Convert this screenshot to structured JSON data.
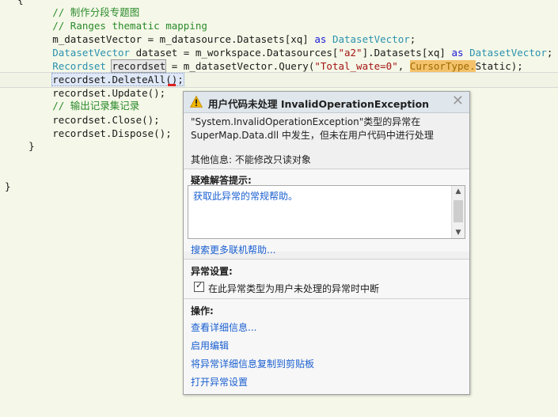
{
  "code": {
    "lines": [
      {
        "parts": [
          {
            "t": "        "
          },
          {
            "t": "// 制作分段专题图",
            "c": "comment"
          }
        ]
      },
      {
        "parts": [
          {
            "t": "        "
          },
          {
            "t": "// Ranges thematic mapping",
            "c": "comment"
          }
        ]
      },
      {
        "parts": [
          {
            "t": "        m_datasetVector = m_datasource.Datasets[xq] "
          },
          {
            "t": "as",
            "c": "kw"
          },
          {
            "t": " "
          },
          {
            "t": "DatasetVector",
            "c": "type"
          },
          {
            "t": ";"
          }
        ]
      },
      {
        "parts": [
          {
            "t": "        "
          },
          {
            "t": "DatasetVector",
            "c": "type"
          },
          {
            "t": " dataset = m_workspace.Datasources["
          },
          {
            "t": "\"a2\"",
            "c": "str"
          },
          {
            "t": "].Datasets[xq] "
          },
          {
            "t": "as",
            "c": "kw"
          },
          {
            "t": " "
          },
          {
            "t": "DatasetVector",
            "c": "type"
          },
          {
            "t": ";"
          }
        ]
      },
      {
        "parts": [
          {
            "t": "        "
          },
          {
            "t": "Recordset",
            "c": "type"
          },
          {
            "t": " "
          },
          {
            "t": "recordset",
            "c": "hl-ref"
          },
          {
            "t": " = m_datasetVector.Query("
          },
          {
            "t": "\"Total_wate=0\"",
            "c": "str"
          },
          {
            "t": ", "
          },
          {
            "t": "CursorType.",
            "c": "hl-warn"
          },
          {
            "t": "Static);"
          }
        ]
      },
      {
        "parts": [
          {
            "t": "        "
          },
          {
            "t": "recordset.DeleteAll();",
            "c": "cur-stmt"
          }
        ]
      },
      {
        "parts": [
          {
            "t": "        recordset.Update();"
          }
        ]
      },
      {
        "parts": [
          {
            "t": "        "
          },
          {
            "t": "// 输出记录集记录",
            "c": "comment"
          }
        ]
      },
      {
        "parts": [
          {
            "t": "        recordset.Close();"
          }
        ]
      },
      {
        "parts": [
          {
            "t": "        recordset.Dispose();"
          }
        ]
      },
      {
        "parts": [
          {
            "t": "    }"
          }
        ]
      },
      {
        "parts": [
          {
            "t": ""
          }
        ]
      },
      {
        "parts": [
          {
            "t": ""
          }
        ]
      },
      {
        "parts": [
          {
            "t": "}"
          }
        ]
      }
    ]
  },
  "popup": {
    "title": "用户代码未处理 InvalidOperationException",
    "close_glyph": "✕",
    "message_line1": "\"System.InvalidOperationException\"类型的异常在",
    "message_line2": "SuperMap.Data.dll 中发生，但未在用户代码中进行处理",
    "extra_info": "其他信息: 不能修改只读对象",
    "troubleshooting_title": "疑难解答提示:",
    "help_link": "获取此异常的常规帮助。",
    "search_more": "搜索更多联机帮助...",
    "exception_settings_title": "异常设置:",
    "break_checkbox_label": "在此异常类型为用户未处理的异常时中断",
    "break_checked": true,
    "actions_title": "操作:",
    "actions": [
      "查看详细信息...",
      "启用编辑",
      "将异常详细信息复制到剪贴板",
      "打开异常设置"
    ],
    "icon": "warning-icon"
  },
  "colors": {
    "editor_bg": "#f5f8e8",
    "comment": "#2b8a2b",
    "type": "#2b91af",
    "keyword": "#1a1ad6",
    "string": "#a31515",
    "link": "#1a5fd0",
    "warning_highlight": "#f3c26b"
  }
}
